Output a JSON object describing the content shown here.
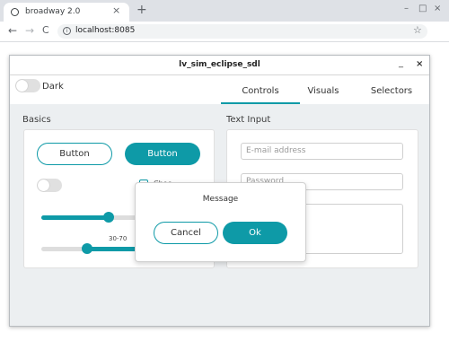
{
  "browser": {
    "tab_title": "broadway 2.0",
    "tab_close": "×",
    "new_tab": "+",
    "window_controls": {
      "minimize": "–",
      "maximize": "□",
      "close": "×"
    },
    "nav": {
      "back": "←",
      "forward": "→",
      "reload": "C"
    },
    "url": "localhost:8085",
    "info_glyph": "i",
    "bookmark_star": "☆"
  },
  "app": {
    "title": "lv_sim_eclipse_sdl",
    "minimize": "_",
    "close": "×",
    "dark_label": "Dark",
    "dark_enabled": false,
    "tabs": [
      {
        "label": "Controls",
        "active": true
      },
      {
        "label": "Visuals",
        "active": false
      },
      {
        "label": "Selectors",
        "active": false
      }
    ],
    "basics": {
      "title": "Basics",
      "button_outline_label": "Button",
      "button_filled_label": "Button",
      "switch_enabled": false,
      "checkbox_label": "Chec...",
      "slider_fraction": 0.5,
      "range_label": "30-70"
    },
    "text_input": {
      "title": "Text Input",
      "email_placeholder": "E-mail address",
      "password_placeholder": "Password"
    },
    "dialog": {
      "title": "Message",
      "cancel_label": "Cancel",
      "ok_label": "Ok"
    },
    "colors": {
      "accent": "#0e9aa7",
      "background": "#eceff1",
      "card": "#ffffff"
    }
  }
}
